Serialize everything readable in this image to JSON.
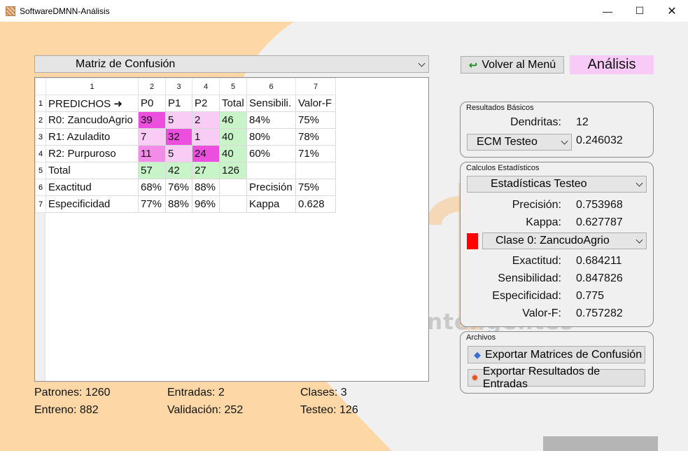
{
  "window": {
    "title": "SoftwareDMNN-Análisis",
    "minimize_glyph": "—",
    "maximize_glyph": "☐",
    "close_glyph": "✕"
  },
  "colors": {
    "orange_bg": "#fdd8a6",
    "magenta": "#ec4fde",
    "light_pink": "#f9ccf6",
    "green": "#c9f4c9",
    "analisis_bg": "#f8cbf7",
    "red_swatch": "#ff0000"
  },
  "watermark": {
    "letter": "S",
    "text": "nteligentes"
  },
  "matrix_selector": {
    "selected": "Matriz de Confusión"
  },
  "grid": {
    "col_numbers": [
      "1",
      "2",
      "3",
      "4",
      "5",
      "6",
      "7"
    ],
    "row_numbers": [
      "1",
      "2",
      "3",
      "4",
      "5",
      "6",
      "7"
    ],
    "header": [
      "PREDICHOS ➜",
      "P0",
      "P1",
      "P2",
      "Total",
      "Sensibili.",
      "Valor-F"
    ],
    "rows": [
      [
        "R0: ZancudoAgrio",
        "39",
        "5",
        "2",
        "46",
        "84%",
        "75%"
      ],
      [
        "R1: Azuladito",
        "7",
        "32",
        "1",
        "40",
        "80%",
        "78%"
      ],
      [
        "R2: Purpuroso",
        "11",
        "5",
        "24",
        "40",
        "60%",
        "71%"
      ],
      [
        "Total",
        "57",
        "42",
        "27",
        "126",
        "",
        ""
      ],
      [
        "Exactitud",
        "68%",
        "76%",
        "88%",
        "",
        "Precisión",
        "75%"
      ],
      [
        "Especificidad",
        "77%",
        "88%",
        "96%",
        "",
        "Kappa",
        "0.628"
      ]
    ]
  },
  "footer_stats": {
    "patrones": "Patrones: 1260",
    "entradas": "Entradas: 2",
    "clases": "Clases: 3",
    "entreno": "Entreno: 882",
    "validacion": "Validación: 252",
    "testeo": "Testeo: 126"
  },
  "nav": {
    "back_label": "Volver al Menú",
    "back_icon": "green-return-arrow",
    "section_label": "Análisis"
  },
  "basic_results": {
    "group_title": "Resultados Básicos",
    "dendritas_label": "Dendritas:",
    "dendritas_value": "12",
    "ecm_selected": "ECM Testeo",
    "ecm_value": "0.246032"
  },
  "stats": {
    "group_title": "Calculos Estadísticos",
    "selected_set": "Estadísticas Testeo",
    "precision_label": "Precisión:",
    "precision_value": "0.753968",
    "kappa_label": "Kappa:",
    "kappa_value": "0.627787",
    "class_selected": "Clase 0: ZancudoAgrio",
    "exactitud_label": "Exactitud:",
    "exactitud_value": "0.684211",
    "sensibilidad_label": "Sensibilidad:",
    "sensibilidad_value": "0.847826",
    "especificidad_label": "Especificidad:",
    "especificidad_value": "0.775",
    "valorf_label": "Valor-F:",
    "valorf_value": "0.757282"
  },
  "files": {
    "group_title": "Archivos",
    "export_matrices": "Exportar Matrices de Confusión",
    "export_results": "Exportar Resultados de Entradas"
  }
}
